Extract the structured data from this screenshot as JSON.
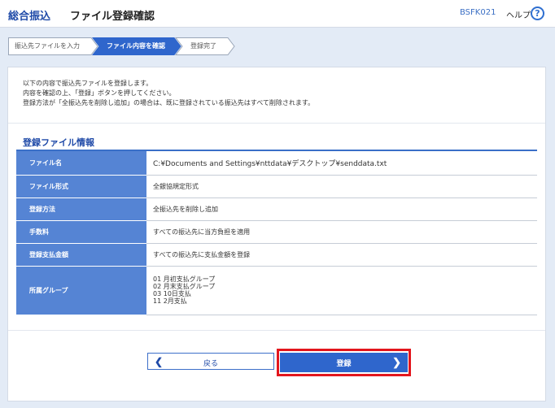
{
  "header": {
    "app_title": "総合振込",
    "page_title": "ファイル登録確認",
    "screen_id": "BSFK021",
    "help_label": "ヘルプ",
    "help_icon": "?"
  },
  "steps": [
    {
      "label": "振込先ファイルを入力",
      "state": "done"
    },
    {
      "label": "ファイル内容を確認",
      "state": "active"
    },
    {
      "label": "登録完了",
      "state": "pending"
    }
  ],
  "intro": {
    "line1": "以下の内容で振込先ファイルを登録します。",
    "line2": "内容を確認の上、「登録」ボタンを押してください。",
    "line3": "登録方法が「全振込先を削除し追加」の場合は、既に登録されている振込先はすべて削除されます。"
  },
  "section": {
    "title": "登録ファイル情報"
  },
  "file_info": {
    "rows": [
      {
        "label": "ファイル名",
        "value": "C:¥Documents and Settings¥nttdata¥デスクトップ¥senddata.txt"
      },
      {
        "label": "ファイル形式",
        "value": "全銀協規定形式"
      },
      {
        "label": "登録方法",
        "value": "全振込先を削除し追加"
      },
      {
        "label": "手数料",
        "value": "すべての振込先に当方負担を適用"
      },
      {
        "label": "登録支払金額",
        "value": "すべての振込先に支払金額を登録"
      }
    ],
    "group_label": "所属グループ",
    "groups": [
      "01 月初支払グループ",
      "02 月末支払グループ",
      "03 10日支払",
      "11 2月支払"
    ]
  },
  "buttons": {
    "back_label": "戻る",
    "register_label": "登録"
  },
  "colors": {
    "accent": "#2f66cc",
    "header_cell": "#5584d4",
    "highlight_outline": "#e3161d"
  }
}
